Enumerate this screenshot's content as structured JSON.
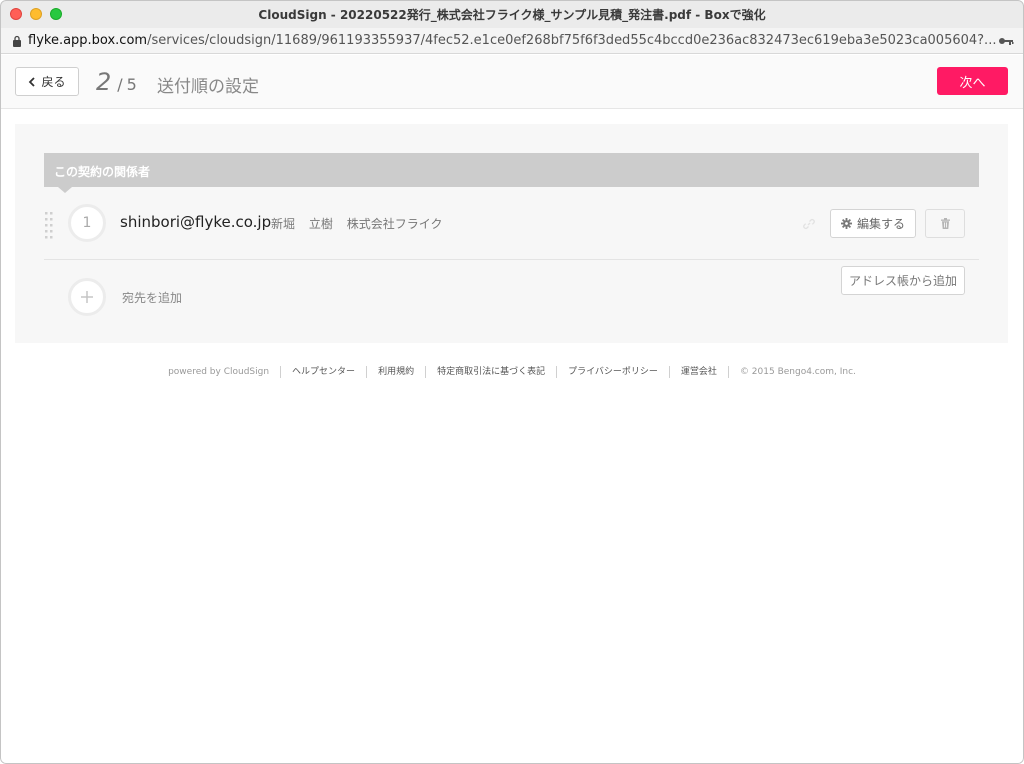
{
  "window": {
    "title": "CloudSign - 20220522発行_株式会社フライク様_サンプル見積_発注書.pdf - Boxで強化"
  },
  "urlbar": {
    "host": "flyke.app.box.com",
    "path": "/services/cloudsign/11689/961193355937/4fec52.e1ce0ef268bf75f6f3ded55c4bccd0e236ac832473ec619eba3e5023ca005604?..."
  },
  "header": {
    "back_label": "戻る",
    "step_current": "2",
    "step_separator": "/",
    "step_total": "5",
    "title": "送付順の設定",
    "next_label": "次へ",
    "accent_color": "#ff1a64"
  },
  "section": {
    "label": "この契約の関係者"
  },
  "recipients": [
    {
      "order": "1",
      "email": "shinbori@flyke.co.jp",
      "last_name": "新堀",
      "first_name": "立樹",
      "company": "株式会社フライク",
      "edit_label": "編集する"
    }
  ],
  "add": {
    "label": "宛先を追加",
    "address_book_label": "アドレス帳から追加"
  },
  "footer": {
    "powered": "powered by CloudSign",
    "links": [
      "ヘルプセンター",
      "利用規約",
      "特定商取引法に基づく表記",
      "プライバシーポリシー",
      "運営会社"
    ],
    "copyright": "© 2015 Bengo4.com, Inc."
  },
  "icons": {
    "lock": "lock-icon",
    "key": "key-icon",
    "back": "chevron-left-icon",
    "drag": "drag-handle-icon",
    "link": "link-icon",
    "gear": "gear-icon",
    "trash": "trash-icon",
    "plus": "plus-icon"
  }
}
